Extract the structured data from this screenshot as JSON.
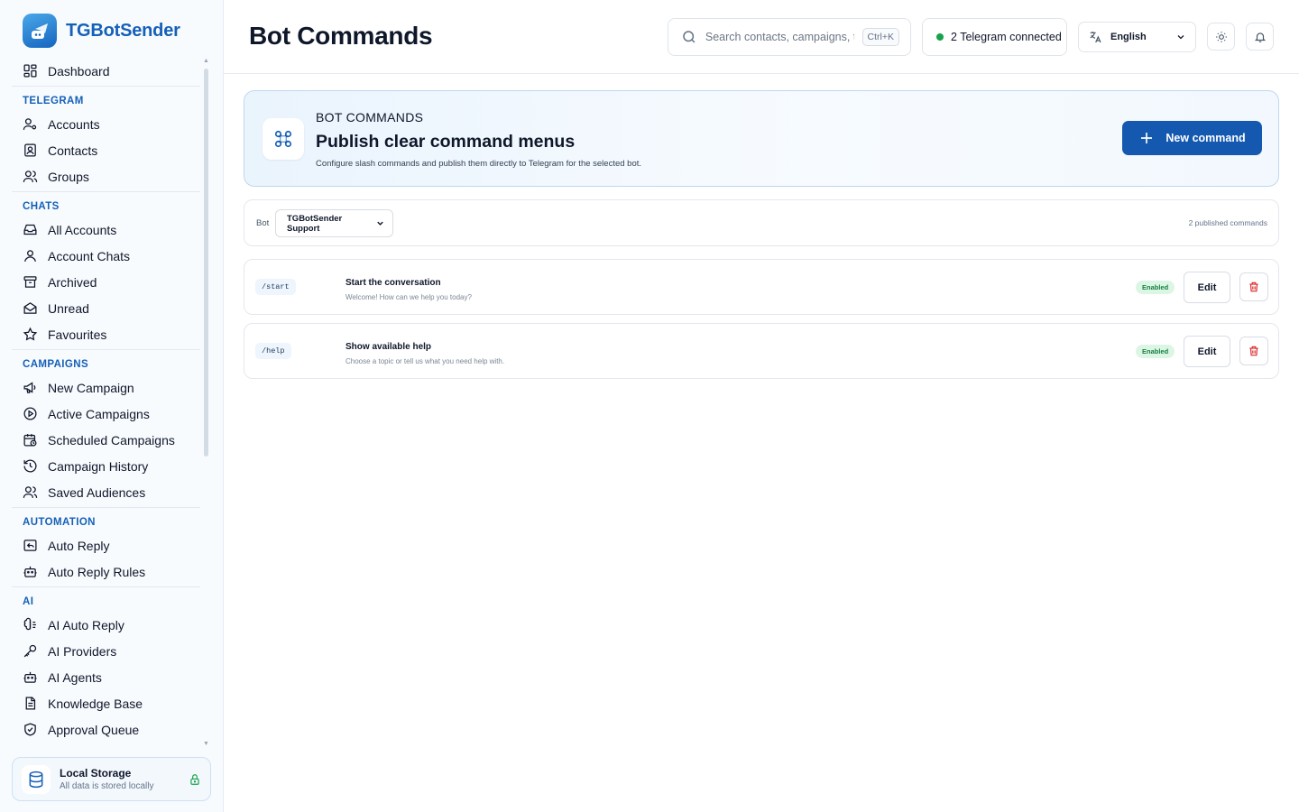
{
  "app": {
    "name": "TGBotSender"
  },
  "sidebar": {
    "dashboard": "Dashboard",
    "sections": [
      {
        "title": "TELEGRAM",
        "items": [
          "Accounts",
          "Contacts",
          "Groups"
        ]
      },
      {
        "title": "CHATS",
        "items": [
          "All Accounts",
          "Account Chats",
          "Archived",
          "Unread",
          "Favourites"
        ]
      },
      {
        "title": "CAMPAIGNS",
        "items": [
          "New Campaign",
          "Active Campaigns",
          "Scheduled Campaigns",
          "Campaign History",
          "Saved Audiences"
        ]
      },
      {
        "title": "AUTOMATION",
        "items": [
          "Auto Reply",
          "Auto Reply Rules"
        ]
      },
      {
        "title": "AI",
        "items": [
          "AI Auto Reply",
          "AI Providers",
          "AI Agents",
          "Knowledge Base",
          "Approval Queue"
        ]
      }
    ],
    "storage": {
      "title": "Local Storage",
      "subtitle": "All data is stored locally"
    }
  },
  "header": {
    "title": "Bot Commands",
    "search_placeholder": "Search contacts, campaigns, t...",
    "search_shortcut": "Ctrl+K",
    "telegram_status": "2 Telegram connected",
    "language": "English"
  },
  "hero": {
    "eyebrow": "BOT COMMANDS",
    "title": "Publish clear command menus",
    "description": "Configure slash commands and publish them directly to Telegram for the selected bot.",
    "button": "New command"
  },
  "bot_bar": {
    "label": "Bot",
    "selected_bot": "TGBotSender Support",
    "published_count": "2 published commands"
  },
  "commands": [
    {
      "command": "/start",
      "title": "Start the conversation",
      "description": "Welcome! How can we help you today?",
      "status": "Enabled",
      "edit_label": "Edit"
    },
    {
      "command": "/help",
      "title": "Show available help",
      "description": "Choose a topic or tell us what you need help with.",
      "status": "Enabled",
      "edit_label": "Edit"
    }
  ],
  "colors": {
    "brand": "#1560b8",
    "primary_button": "#1458b0",
    "status_green": "#16a34a",
    "danger": "#dc2626"
  }
}
